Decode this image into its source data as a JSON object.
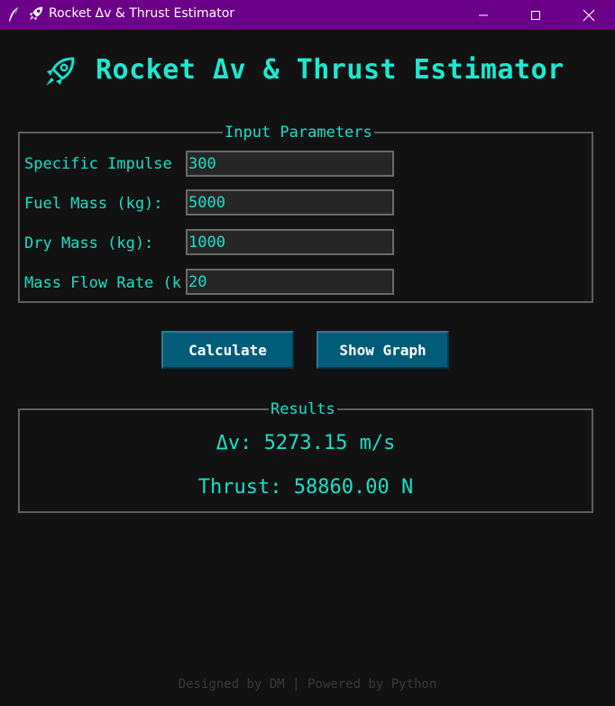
{
  "window": {
    "title": "Rocket Δv & Thrust Estimator",
    "app_icon": "quill-icon",
    "title_icon": "rocket-icon",
    "controls": [
      "minimize",
      "maximize",
      "close"
    ]
  },
  "header": {
    "icon": "rocket-icon",
    "title": "Rocket Δv & Thrust Estimator"
  },
  "inputs": {
    "legend": "Input Parameters",
    "fields": [
      {
        "label": "Specific Impulse (s):",
        "value": "300"
      },
      {
        "label": "Fuel Mass (kg):",
        "value": "5000"
      },
      {
        "label": "Dry Mass (kg):",
        "value": "1000"
      },
      {
        "label": "Mass Flow Rate (kg/s):",
        "value": "20"
      }
    ]
  },
  "buttons": {
    "calculate": "Calculate",
    "show_graph": "Show Graph"
  },
  "results": {
    "legend": "Results",
    "delta_v": "Δv: 5273.15 m/s",
    "thrust": "Thrust: 58860.00 N"
  },
  "footer": "Designed by DM | Powered by Python",
  "colors": {
    "accent": "#18e0c8",
    "background": "#121212",
    "titlebar": "#6c0088",
    "button": "#005c78",
    "border": "#5f5f5f"
  }
}
